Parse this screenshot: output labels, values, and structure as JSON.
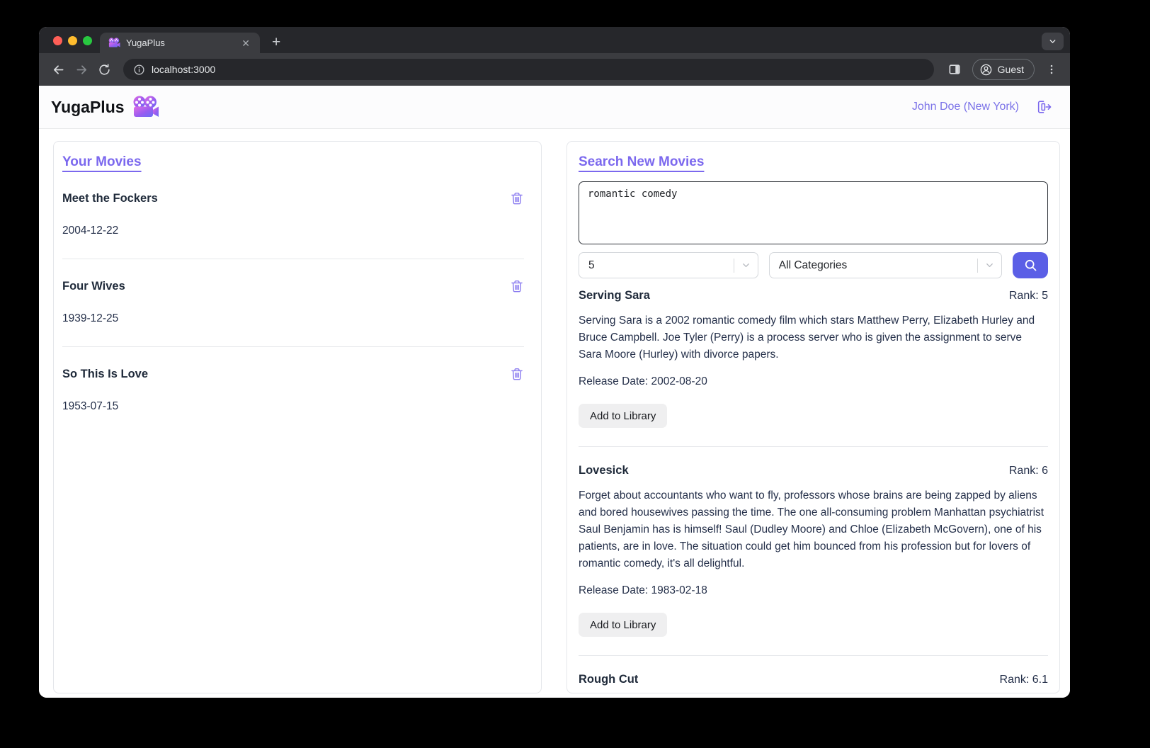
{
  "browser": {
    "tab_title": "YugaPlus",
    "url": "localhost:3000",
    "guest_label": "Guest"
  },
  "header": {
    "app_name": "YugaPlus",
    "user_label": "John Doe (New York)"
  },
  "library": {
    "title": "Your Movies",
    "movies": [
      {
        "title": "Meet the Fockers",
        "date": "2004-12-22"
      },
      {
        "title": "Four Wives",
        "date": "1939-12-25"
      },
      {
        "title": "So This Is Love",
        "date": "1953-07-15"
      }
    ]
  },
  "search": {
    "title": "Search New Movies",
    "query": "romantic comedy",
    "max_results": "5",
    "category": "All Categories",
    "add_button_label": "Add to Library",
    "results": [
      {
        "title": "Serving Sara",
        "rank": "Rank: 5",
        "description": "Serving Sara is a 2002 romantic comedy film which stars Matthew Perry, Elizabeth Hurley and Bruce Campbell. Joe Tyler (Perry) is a process server who is given the assignment to serve Sara Moore (Hurley) with divorce papers.",
        "release": "Release Date: 2002-08-20"
      },
      {
        "title": "Lovesick",
        "rank": "Rank: 6",
        "description": "Forget about accountants who want to fly, professors whose brains are being zapped by aliens and bored housewives passing the time. The one all-consuming problem Manhattan psychiatrist Saul Benjamin has is himself! Saul (Dudley Moore) and Chloe (Elizabeth McGovern), one of his patients, are in love. The situation could get him bounced from his profession but for lovers of romantic comedy, it's all delightful.",
        "release": "Release Date: 1983-02-18"
      },
      {
        "title": "Rough Cut",
        "rank": "Rank: 6.1"
      }
    ]
  },
  "colors": {
    "accent_purple": "#7b68ee",
    "search_button": "#5b5fe6",
    "title_text": "#1f2a3a",
    "traffic_red": "#ff5f57",
    "traffic_yellow": "#febc2e",
    "traffic_green": "#28c840"
  }
}
